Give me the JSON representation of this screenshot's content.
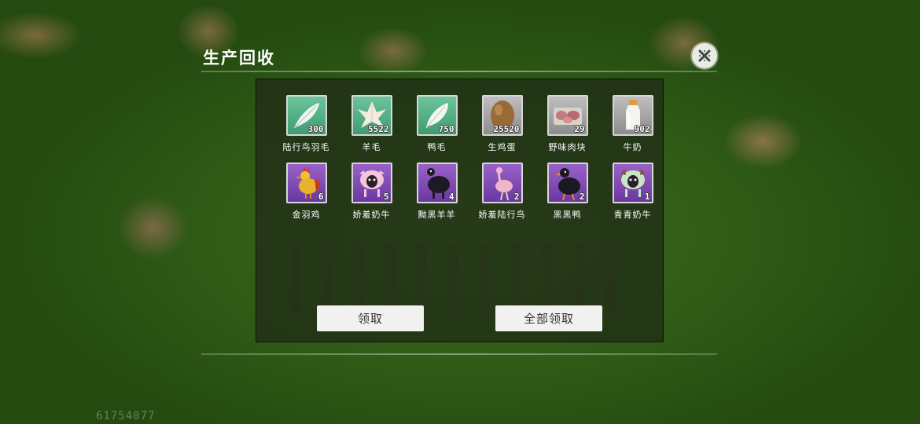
{
  "panel": {
    "title": "生产回收",
    "close_icon": "close-x-icon"
  },
  "items": [
    {
      "name": "陆行鸟羽毛",
      "count": "300",
      "icon": "feather-icon",
      "bg": "green"
    },
    {
      "name": "羊毛",
      "count": "5522",
      "icon": "wool-icon",
      "bg": "green"
    },
    {
      "name": "鸭毛",
      "count": "750",
      "icon": "feather-icon",
      "bg": "green"
    },
    {
      "name": "生鸡蛋",
      "count": "25520",
      "icon": "egg-icon",
      "bg": "gray"
    },
    {
      "name": "野味肉块",
      "count": "29",
      "icon": "meat-icon",
      "bg": "gray"
    },
    {
      "name": "牛奶",
      "count": "902",
      "icon": "milk-bottle-icon",
      "bg": "gray"
    },
    {
      "name": "金羽鸡",
      "count": "6",
      "icon": "rooster-icon",
      "bg": "purple"
    },
    {
      "name": "娇羞奶牛",
      "count": "5",
      "icon": "pink-cow-icon",
      "bg": "purple"
    },
    {
      "name": "黝黑羊羊",
      "count": "4",
      "icon": "black-sheep-icon",
      "bg": "purple"
    },
    {
      "name": "娇羞陆行鸟",
      "count": "2",
      "icon": "pink-ostrich-icon",
      "bg": "purple"
    },
    {
      "name": "黑黑鸭",
      "count": "2",
      "icon": "black-duck-icon",
      "bg": "purple"
    },
    {
      "name": "青青奶牛",
      "count": "1",
      "icon": "green-cow-icon",
      "bg": "purple"
    }
  ],
  "buttons": {
    "claim": "领取",
    "claim_all": "全部领取"
  },
  "uid": "61754077"
}
